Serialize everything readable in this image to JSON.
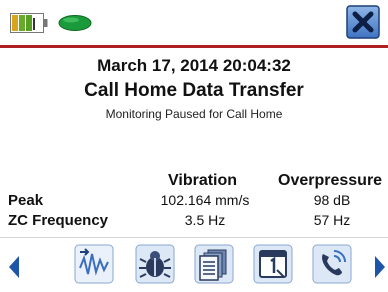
{
  "header": {
    "battery_icon": "battery-icon",
    "status_led_icon": "status-led-icon",
    "close_icon": "close-icon",
    "accent_color": "#b02020",
    "led_color": "#1a9a3a"
  },
  "main": {
    "datetime": "March 17, 2014 20:04:32",
    "title": "Call Home Data Transfer",
    "subtitle": "Monitoring Paused for Call Home"
  },
  "table": {
    "columns": [
      "Vibration",
      "Overpressure"
    ],
    "rows": [
      {
        "label": "Peak",
        "vibration": "102.164 mm/s",
        "overpressure": "98 dB"
      },
      {
        "label": "ZC Frequency",
        "vibration": "3.5 Hz",
        "overpressure": "57 Hz"
      }
    ]
  },
  "toolbar": {
    "prev_icon": "chevron-left-icon",
    "next_icon": "chevron-right-icon",
    "tools": [
      {
        "icon": "waveform-download-icon"
      },
      {
        "icon": "bug-icon"
      },
      {
        "icon": "documents-icon"
      },
      {
        "icon": "calendar-icon"
      },
      {
        "icon": "phone-call-icon"
      }
    ]
  }
}
